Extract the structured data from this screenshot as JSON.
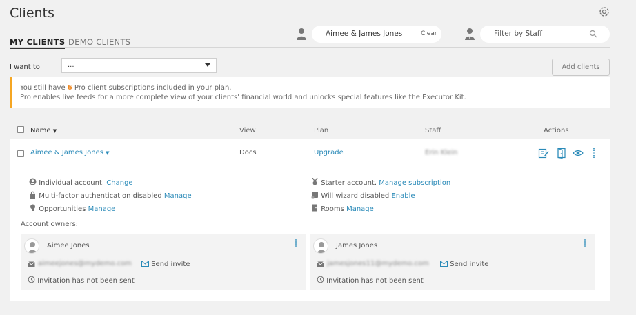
{
  "page": {
    "title": "Clients"
  },
  "tabs": [
    {
      "label": "MY CLIENTS"
    },
    {
      "label": "DEMO CLIENTS"
    }
  ],
  "client_filter": {
    "value": "Aimee & James Jones",
    "clear_label": "Clear"
  },
  "staff_filter": {
    "placeholder": "Filter by Staff"
  },
  "action_select": {
    "label": "I want to",
    "value": "..."
  },
  "add_clients_label": "Add clients",
  "banner": {
    "line1_before": "You still have ",
    "count": "6",
    "line1_after": " Pro client subscriptions included in your plan.",
    "line2": "Pro enables live feeds for a more complete view of your clients' financial world and unlocks special features like the Executor Kit."
  },
  "table": {
    "headers": {
      "name": "Name",
      "view": "View",
      "plan": "Plan",
      "staff": "Staff",
      "actions": "Actions"
    },
    "row": {
      "name": "Aimee & James Jones",
      "view": "Docs",
      "plan": "Upgrade",
      "staff": "Erin Klein"
    }
  },
  "details": {
    "left": [
      {
        "text": "Individual account.",
        "link": "Change",
        "icon": "user-circle-icon"
      },
      {
        "text": "Multi-factor authentication disabled",
        "link": "Manage",
        "icon": "lock-icon"
      },
      {
        "text": "Opportunities",
        "link": "Manage",
        "icon": "lightbulb-icon"
      }
    ],
    "right": [
      {
        "text": "Starter account.",
        "link": "Manage subscription",
        "icon": "medal-icon"
      },
      {
        "text": "Will wizard disabled",
        "link": "Enable",
        "icon": "scroll-icon"
      },
      {
        "text": "Rooms",
        "link": "Manage",
        "icon": "door-icon"
      }
    ]
  },
  "owners_label": "Account owners:",
  "owners": [
    {
      "name": "Aimee Jones",
      "email": "aimeejones@mydemo.com",
      "invite": "Send invite",
      "status": "Invitation has not been sent"
    },
    {
      "name": "James Jones",
      "email": "jamesjones11@mydemo.com",
      "invite": "Send invite",
      "status": "Invitation has not been sent"
    }
  ],
  "colors": {
    "accent": "#2a8ab8",
    "warning": "#f5a623",
    "background": "#f1f1f1"
  }
}
